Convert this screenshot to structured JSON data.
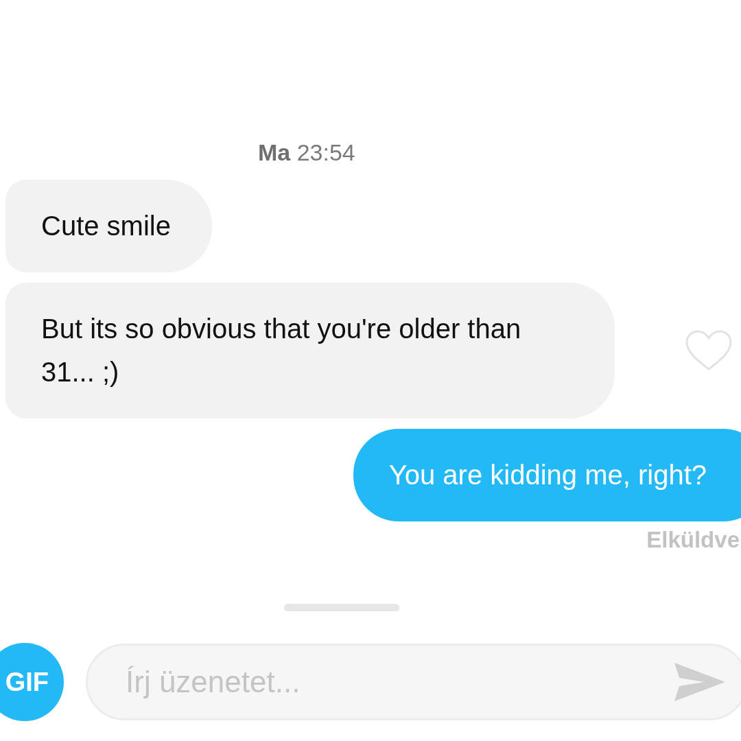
{
  "timestamp": "**Ma** 23:54",
  "messages": [
    {
      "kind": "received",
      "text": "Cute smile"
    },
    {
      "kind": "received",
      "text": "But its so obvious that you're older than 31... ;)",
      "liked": false
    },
    {
      "kind": "sent",
      "text": "You are kidding me, right?"
    }
  ],
  "delivery_status": "Elküldve",
  "composer": {
    "gif_button": "GIF",
    "placeholder": "Írj üzenetet..."
  }
}
